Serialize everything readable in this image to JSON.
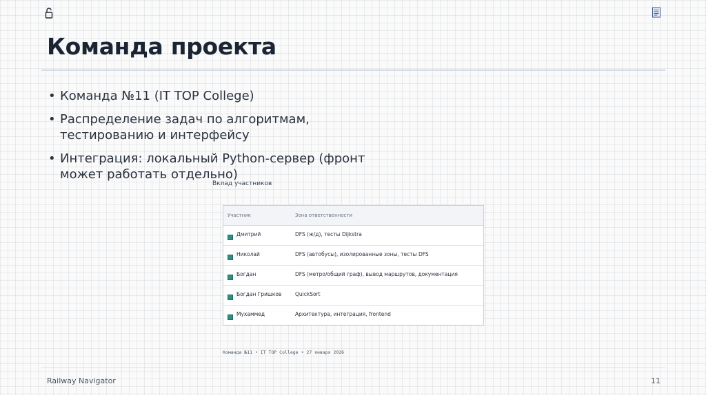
{
  "header": {
    "title": "Команда проекта",
    "lock_icon": "unlock-icon",
    "doc_icon": "document-icon"
  },
  "bullets": [
    "Команда №11 (IT TOP College)",
    "Распределение задач по алгоритмам, тестированию и интерфейсу",
    "Интеграция: локальный Python-сервер (фронт может работать отдельно)"
  ],
  "table": {
    "caption": "Вклад участников",
    "headers": [
      "Участник",
      "Зона ответственности"
    ],
    "rows": [
      {
        "name": "Дмитрий",
        "zone": "DFS (ж/д), тесты Dijkstra"
      },
      {
        "name": "Николай",
        "zone": "DFS (автобусы), изолированные зоны, тесты DFS"
      },
      {
        "name": "Богдан",
        "zone": "DFS (метро/общий граф), вывод маршрутов, документация"
      },
      {
        "name": "Богдан Гришков",
        "zone": "QuickSort"
      },
      {
        "name": "Мухаммед",
        "zone": "Архитектура, интеграция, frontend"
      }
    ],
    "marker_color": "#2f8f83"
  },
  "footer_note": "Команда №11 • IT TOP College • 27 января 2026",
  "footer": {
    "app_name": "Railway Navigator",
    "page_number": "11"
  }
}
